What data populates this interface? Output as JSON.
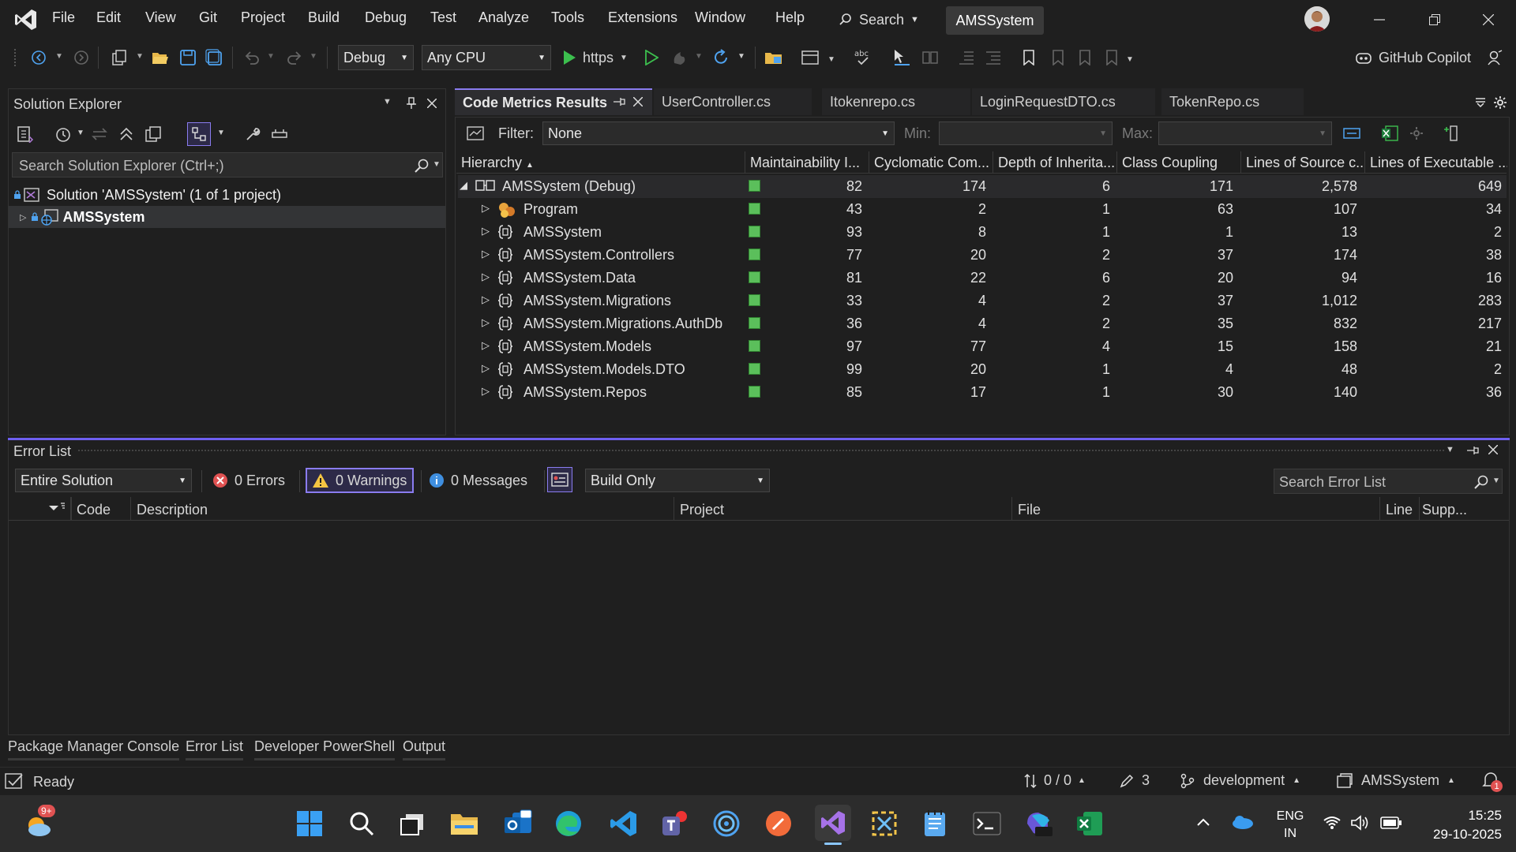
{
  "menu": [
    "File",
    "Edit",
    "View",
    "Git",
    "Project",
    "Build",
    "Debug",
    "Test",
    "Analyze",
    "Tools",
    "Extensions",
    "Window",
    "Help"
  ],
  "search_label": "Search",
  "project_badge": "AMSSystem",
  "toolbar": {
    "config": "Debug",
    "platform": "Any CPU",
    "run_label": "https",
    "copilot": "GitHub Copilot"
  },
  "solution_explorer": {
    "title": "Solution Explorer",
    "search_placeholder": "Search Solution Explorer (Ctrl+;)",
    "solution_label": "Solution 'AMSSystem' (1 of 1 project)",
    "project_label": "AMSSystem"
  },
  "tabs": [
    {
      "label": "Code Metrics Results",
      "active": true
    },
    {
      "label": "UserController.cs",
      "active": false
    },
    {
      "label": "Itokenrepo.cs",
      "active": false
    },
    {
      "label": "LoginRequestDTO.cs",
      "active": false
    },
    {
      "label": "TokenRepo.cs",
      "active": false
    }
  ],
  "metrics": {
    "filter_label": "Filter:",
    "filter_value": "None",
    "min_label": "Min:",
    "max_label": "Max:",
    "columns": [
      "Hierarchy",
      "Maintainability I...",
      "Cyclomatic Com...",
      "Depth of Inherita...",
      "Class Coupling",
      "Lines of Source c...",
      "Lines of Executable ..."
    ],
    "rows": [
      {
        "name": "AMSSystem (Debug)",
        "mi": "82",
        "cc": "174",
        "doi": "6",
        "coupling": "171",
        "sloc": "2,578",
        "eloc": "649",
        "level": 0,
        "icon": "assembly"
      },
      {
        "name": "Program",
        "mi": "43",
        "cc": "2",
        "doi": "1",
        "coupling": "63",
        "sloc": "107",
        "eloc": "34",
        "level": 1,
        "icon": "class"
      },
      {
        "name": "AMSSystem",
        "mi": "93",
        "cc": "8",
        "doi": "1",
        "coupling": "1",
        "sloc": "13",
        "eloc": "2",
        "level": 1,
        "icon": "namespace"
      },
      {
        "name": "AMSSystem.Controllers",
        "mi": "77",
        "cc": "20",
        "doi": "2",
        "coupling": "37",
        "sloc": "174",
        "eloc": "38",
        "level": 1,
        "icon": "namespace"
      },
      {
        "name": "AMSSystem.Data",
        "mi": "81",
        "cc": "22",
        "doi": "6",
        "coupling": "20",
        "sloc": "94",
        "eloc": "16",
        "level": 1,
        "icon": "namespace"
      },
      {
        "name": "AMSSystem.Migrations",
        "mi": "33",
        "cc": "4",
        "doi": "2",
        "coupling": "37",
        "sloc": "1,012",
        "eloc": "283",
        "level": 1,
        "icon": "namespace"
      },
      {
        "name": "AMSSystem.Migrations.AuthDb",
        "mi": "36",
        "cc": "4",
        "doi": "2",
        "coupling": "35",
        "sloc": "832",
        "eloc": "217",
        "level": 1,
        "icon": "namespace"
      },
      {
        "name": "AMSSystem.Models",
        "mi": "97",
        "cc": "77",
        "doi": "4",
        "coupling": "15",
        "sloc": "158",
        "eloc": "21",
        "level": 1,
        "icon": "namespace"
      },
      {
        "name": "AMSSystem.Models.DTO",
        "mi": "99",
        "cc": "20",
        "doi": "1",
        "coupling": "4",
        "sloc": "48",
        "eloc": "2",
        "level": 1,
        "icon": "namespace"
      },
      {
        "name": "AMSSystem.Repos",
        "mi": "85",
        "cc": "17",
        "doi": "1",
        "coupling": "30",
        "sloc": "140",
        "eloc": "36",
        "level": 1,
        "icon": "namespace"
      }
    ]
  },
  "error_list": {
    "title": "Error List",
    "scope": "Entire Solution",
    "errors": "0 Errors",
    "warnings": "0 Warnings",
    "messages": "0 Messages",
    "build_filter": "Build Only",
    "search_placeholder": "Search Error List",
    "columns": [
      "Code",
      "Description",
      "Project",
      "File",
      "Line",
      "Supp..."
    ]
  },
  "bottom_tabs": [
    "Package Manager Console",
    "Error List",
    "Developer PowerShell",
    "Output"
  ],
  "status": {
    "ready": "Ready",
    "sync": "0 / 0",
    "edits": "3",
    "branch": "development",
    "repo": "AMSSystem",
    "notifications": "1"
  },
  "taskbar": {
    "weather_badge": "9+",
    "lang1": "ENG",
    "lang2": "IN",
    "time": "15:25",
    "date": "29-10-2025"
  }
}
